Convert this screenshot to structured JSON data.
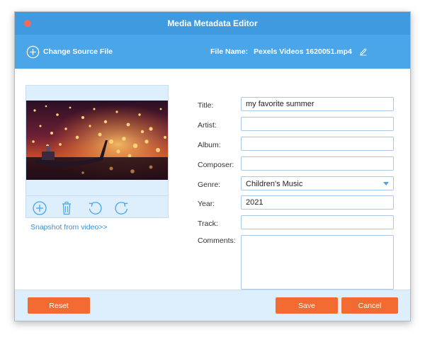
{
  "window": {
    "title": "Media Metadata Editor"
  },
  "toolbar": {
    "change_source_label": "Change Source File",
    "change_source_icon": "plus-circle-icon",
    "file_name_label": "File Name:",
    "file_name_value": "Pexels Videos 1620051.mp4",
    "edit_icon": "pencil-icon"
  },
  "preview": {
    "controls": [
      {
        "name": "add-icon"
      },
      {
        "name": "trash-icon"
      },
      {
        "name": "rotate-left-icon"
      },
      {
        "name": "rotate-right-icon"
      }
    ],
    "snapshot_link": "Snapshot from video>>"
  },
  "form": {
    "title_label": "Title:",
    "title_value": "my favorite summer",
    "artist_label": "Artist:",
    "artist_value": "",
    "album_label": "Album:",
    "album_value": "",
    "composer_label": "Composer:",
    "composer_value": "",
    "genre_label": "Genre:",
    "genre_value": "Children's Music",
    "year_label": "Year:",
    "year_value": "2021",
    "track_label": "Track:",
    "track_value": "",
    "comments_label": "Comments:",
    "comments_value": ""
  },
  "footer": {
    "reset_label": "Reset",
    "save_label": "Save",
    "cancel_label": "Cancel"
  },
  "colors": {
    "titlebar": "#3f9ae0",
    "toolbar": "#4aa5e9",
    "panel": "#ddeefc",
    "button": "#f36b32",
    "link": "#3d8fd6",
    "close": "#f26a5a"
  }
}
